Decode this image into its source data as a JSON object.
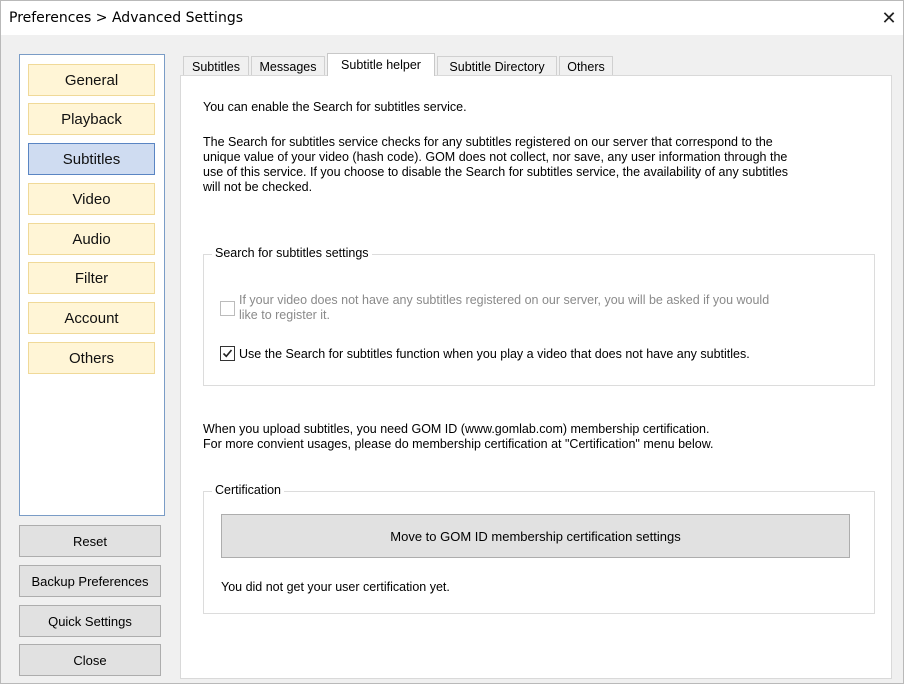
{
  "window": {
    "title": "Preferences > Advanced Settings",
    "close_glyph": "✕"
  },
  "sidebar": {
    "items": [
      {
        "label": "General"
      },
      {
        "label": "Playback"
      },
      {
        "label": "Subtitles",
        "active": true
      },
      {
        "label": "Video"
      },
      {
        "label": "Audio"
      },
      {
        "label": "Filter"
      },
      {
        "label": "Account"
      },
      {
        "label": "Others"
      }
    ]
  },
  "bottom_buttons": {
    "reset": "Reset",
    "backup": "Backup Preferences",
    "quick": "Quick Settings",
    "close": "Close"
  },
  "tabs": [
    {
      "label": "Subtitles"
    },
    {
      "label": "Messages"
    },
    {
      "label": "Subtitle helper",
      "active": true
    },
    {
      "label": "Subtitle Directory"
    },
    {
      "label": "Others"
    }
  ],
  "content": {
    "intro": "You can enable the Search for subtitles service.",
    "desc_lines": [
      "The Search for subtitles service checks for any subtitles registered on our server that correspond to the",
      "unique value of your video (hash code). GOM does not collect, nor save, any user information through the",
      "use of this service. If you choose to disable the Search for subtitles service, the availability of any subtitles",
      "will not be checked."
    ],
    "search_group": {
      "label": "Search for subtitles settings",
      "register_option_lines": [
        "If your video does not have any subtitles registered on our server, you will be asked if you would",
        "like to register it."
      ],
      "register_checked": false,
      "register_enabled": false,
      "use_option": "Use the Search for subtitles function when you play a video that does not have any subtitles.",
      "use_checked": true
    },
    "upload_lines": [
      "When you upload subtitles, you need GOM ID (www.gomlab.com) membership certification.",
      "For more convient usages, please do membership certification at \"Certification\" menu below."
    ],
    "cert_group": {
      "label": "Certification",
      "button": "Move to GOM ID membership certification settings",
      "status": "You did not get your user certification yet."
    }
  },
  "colors": {
    "nav_bg": "#fff5d6",
    "nav_active_bg": "#cfdcf1",
    "nav_active_border": "#5a85c3"
  }
}
